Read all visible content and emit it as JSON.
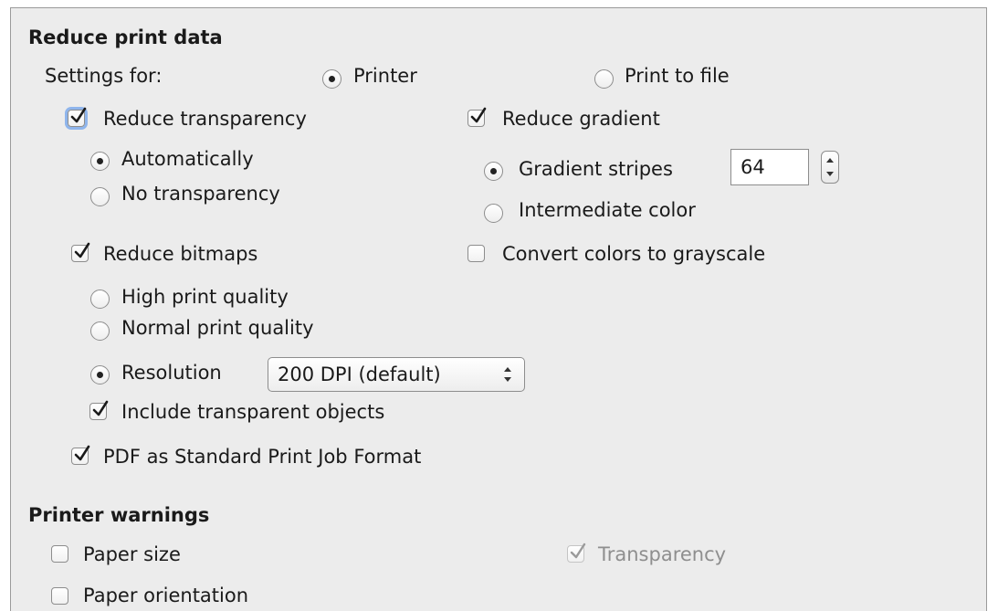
{
  "reduce_print_data": {
    "heading": "Reduce print data",
    "settings_for": {
      "label": "Settings for:",
      "printer": "Printer",
      "print_to_file": "Print to file",
      "selected": "Printer"
    },
    "reduce_transparency": {
      "label": "Reduce transparency",
      "checked": true,
      "automatically": "Automatically",
      "no_transparency": "No transparency",
      "selected": "Automatically"
    },
    "reduce_gradient": {
      "label": "Reduce gradient",
      "checked": true,
      "gradient_stripes": "Gradient stripes",
      "stripes_value": "64",
      "intermediate_color": "Intermediate color",
      "selected": "Gradient stripes"
    },
    "reduce_bitmaps": {
      "label": "Reduce bitmaps",
      "checked": true,
      "high_quality": "High print quality",
      "normal_quality": "Normal print quality",
      "resolution": "Resolution",
      "resolution_value": "200 DPI (default)",
      "selected": "Resolution",
      "include_transparent": "Include transparent objects",
      "include_transparent_checked": true
    },
    "convert_grayscale": {
      "label": "Convert colors to grayscale",
      "checked": false
    },
    "pdf_standard": {
      "label": "PDF as Standard Print Job Format",
      "checked": true
    }
  },
  "printer_warnings": {
    "heading": "Printer warnings",
    "paper_size": {
      "label": "Paper size",
      "checked": false
    },
    "paper_orientation": {
      "label": "Paper orientation",
      "checked": false
    },
    "transparency": {
      "label": "Transparency",
      "checked": true,
      "disabled": true
    }
  },
  "colors": {
    "panel_background": "#ececec",
    "panel_border": "#9a9a9a",
    "focus_ring": "#8fb5ec",
    "disabled_text": "#8e8e8e"
  }
}
